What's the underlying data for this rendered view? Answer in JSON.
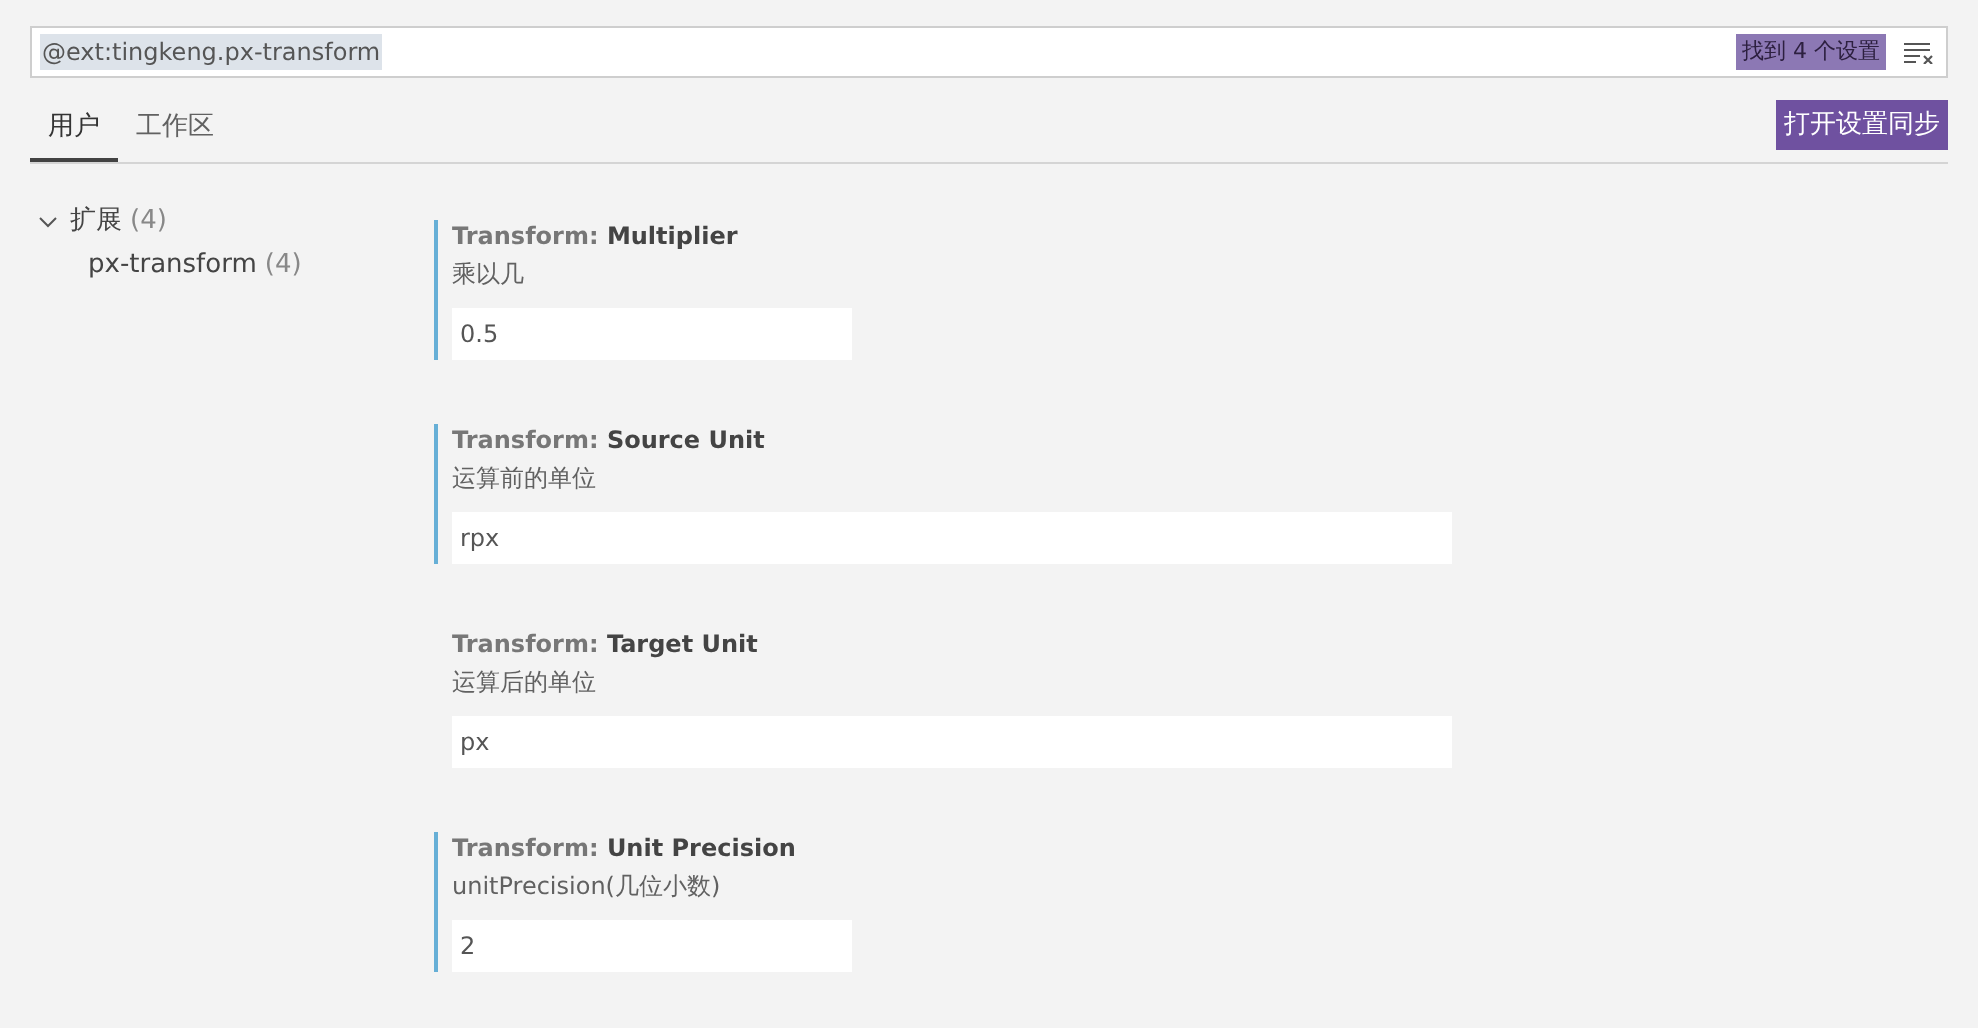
{
  "search": {
    "value": "@ext:tingkeng.px-transform",
    "result_count": "找到 4 个设置"
  },
  "tabs": [
    {
      "label": "用户",
      "selected": true
    },
    {
      "label": "工作区",
      "selected": false
    }
  ],
  "sync_button": "打开设置同步",
  "tree": [
    {
      "label": "扩展",
      "count": "(4)",
      "expanded": true,
      "children": [
        {
          "label": "px-transform",
          "count": "(4)"
        }
      ]
    }
  ],
  "settings": [
    {
      "category": "Transform: ",
      "name": "Multiplier",
      "description": "乘以几",
      "value": "0.5",
      "kind": "number",
      "modified": true
    },
    {
      "category": "Transform: ",
      "name": "Source Unit",
      "description": "运算前的单位",
      "value": "rpx",
      "kind": "string",
      "modified": true
    },
    {
      "category": "Transform: ",
      "name": "Target Unit",
      "description": "运算后的单位",
      "value": "px",
      "kind": "string",
      "modified": false
    },
    {
      "category": "Transform: ",
      "name": "Unit Precision",
      "description": "unitPrecision(几位小数)",
      "value": "2",
      "kind": "number",
      "modified": true
    }
  ]
}
